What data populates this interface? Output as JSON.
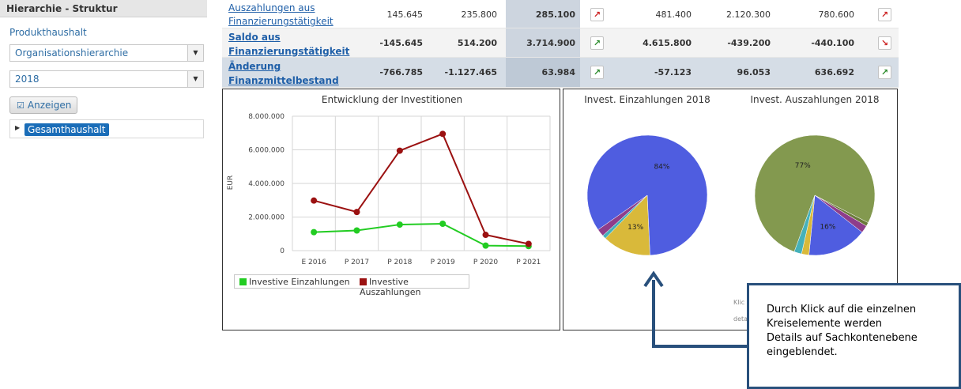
{
  "sidebar": {
    "header": "Hierarchie - Struktur",
    "produkt_label": "Produkthaushalt",
    "hierarchy_select": "Organisationshierarchie",
    "year_select": "2018",
    "show_button": "Anzeigen",
    "tree_node": "Gesamthaushalt"
  },
  "table": {
    "rows": [
      {
        "label_line1": "Auszahlungen aus",
        "label_line2": "Finanzierungstätigkeit",
        "values": [
          "145.645",
          "235.800",
          "285.100",
          "481.400",
          "2.120.300",
          "780.600"
        ],
        "trend1": "up-red",
        "trend2": "up-red"
      },
      {
        "label_line1": "Saldo aus",
        "label_line2": "Finanzierungstätigkeit",
        "values": [
          "-145.645",
          "514.200",
          "3.714.900",
          "4.615.800",
          "-439.200",
          "-440.100"
        ],
        "trend1": "up-green",
        "trend2": "down-red"
      },
      {
        "label_line1": "Änderung",
        "label_line2": "Finanzmittelbestand",
        "values": [
          "-766.785",
          "-1.127.465",
          "63.984",
          "-57.123",
          "96.053",
          "636.692"
        ],
        "trend1": "up-green",
        "trend2": "up-green"
      }
    ]
  },
  "line_chart": {
    "title": "Entwicklung der Investitionen",
    "ylabel": "EUR",
    "y_ticks": [
      "8.000.000",
      "6.000.000",
      "4.000.000",
      "2.000.000",
      "0"
    ],
    "legend": [
      "Investive Einzahlungen",
      "Investive Auszahlungen"
    ]
  },
  "pie_charts": {
    "title_left": "Invest. Einzahlungen 2018",
    "title_right": "Invest. Auszahlungen 2018",
    "left_labels": [
      "84%",
      "13%"
    ],
    "right_labels": [
      "77%",
      "16%"
    ],
    "hidden_note_1": "Klic",
    "hidden_note_2": "deta"
  },
  "callout": {
    "lines": [
      "Durch Klick auf die einzelnen",
      "Kreiselemente werden",
      "Details auf Sachkontenebene",
      "eingeblendet."
    ]
  },
  "colors": {
    "einzahlungen": "#22cc22",
    "auszahlungen": "#9b1111",
    "pie_blue": "#4f5de0",
    "pie_yellow": "#d9b93a",
    "pie_olive": "#83994f",
    "pie_teal": "#45b1b9",
    "pie_purple": "#8e3d8a",
    "callout_border": "#29507c"
  },
  "chart_data": [
    {
      "type": "line",
      "title": "Entwicklung der Investitionen",
      "xlabel": "",
      "ylabel": "EUR",
      "categories": [
        "E 2016",
        "P 2017",
        "P 2018",
        "P 2019",
        "P 2020",
        "P 2021"
      ],
      "ylim": [
        0,
        8000000
      ],
      "grid": true,
      "legend": "bottom-left",
      "series": [
        {
          "name": "Investive Einzahlungen",
          "color": "#22cc22",
          "values": [
            1100000,
            1200000,
            1550000,
            1600000,
            300000,
            270000
          ]
        },
        {
          "name": "Investive Auszahlungen",
          "color": "#9b1111",
          "values": [
            2980000,
            2300000,
            5950000,
            6950000,
            940000,
            400000
          ]
        }
      ]
    },
    {
      "type": "pie",
      "title": "Invest. Einzahlungen 2018",
      "slices": [
        {
          "value": 84,
          "label": "84%",
          "color": "#4f5de0"
        },
        {
          "value": 13,
          "label": "13%",
          "color": "#d9b93a"
        },
        {
          "value": 1,
          "label": "",
          "color": "#45b1b9"
        },
        {
          "value": 2,
          "label": "",
          "color": "#8e3d8a"
        }
      ]
    },
    {
      "type": "pie",
      "title": "Invest. Auszahlungen 2018",
      "slices": [
        {
          "value": 77,
          "label": "77%",
          "color": "#83994f"
        },
        {
          "value": 1,
          "label": "",
          "color": "#6b7a3a"
        },
        {
          "value": 2,
          "label": "",
          "color": "#8e3d8a"
        },
        {
          "value": 16,
          "label": "16%",
          "color": "#4f5de0"
        },
        {
          "value": 2,
          "label": "",
          "color": "#d9b93a"
        },
        {
          "value": 2,
          "label": "",
          "color": "#45b1b9"
        }
      ]
    }
  ]
}
